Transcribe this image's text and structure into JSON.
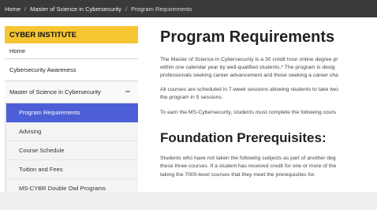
{
  "breadcrumb": {
    "items": [
      "Home",
      "Master of Science in Cybersecurity"
    ],
    "separator": "/",
    "current": "Program Requirements"
  },
  "sidebar": {
    "header": "CYBER INSTITUTE",
    "items": [
      "Home",
      "Cybersecurity Awareness"
    ],
    "parent": {
      "label": "Master of Science in Cybersecurity",
      "toggle": "–"
    },
    "subitems": [
      "Program Requirements",
      "Advising",
      "Course Schedule",
      "Tuition and Fees",
      "MS-CYBR Double Owl Programs"
    ],
    "active_index": 0
  },
  "main": {
    "title": "Program Requirements",
    "intro_lines": [
      "The Master of Science in Cybersecurity is a 30 credit hour online degree pr",
      "within one calendar year by well-qualified students.* The program is desig",
      "professionals seeking career advancement and those seeking a career cha"
    ],
    "schedule_lines": [
      "All courses are scheduled in 7-week sessions allowing students to take two",
      "the program in 5 sessions."
    ],
    "earn_line": "To earn the MS-Cybersecurity, students must complete the following cours",
    "section_title": "Foundation Prerequisites:",
    "prereq_lines": [
      "Students who have not taken the following subjects as part of another deg",
      "these three courses.  If a student has received credit for one or more of the",
      "taking the 7000-level courses that they meet the prerequisites for."
    ]
  },
  "colors": {
    "breadcrumb_bg": "#3a3a3a",
    "sidebar_header": "#f6c532",
    "active_item": "#4c5fd7"
  }
}
